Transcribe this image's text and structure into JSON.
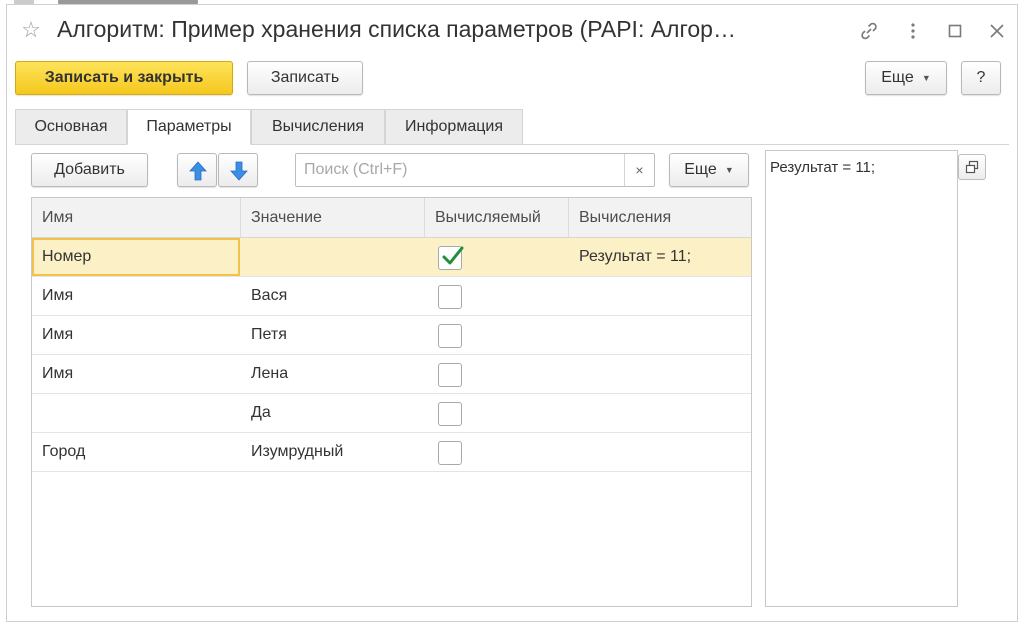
{
  "window": {
    "title": "Алгоритм: Пример хранения списка параметров (PAPI: Алгор…"
  },
  "command_bar": {
    "save_close_label": "Записать и закрыть",
    "save_label": "Записать",
    "more_label": "Еще",
    "help_label": "?"
  },
  "tabs": [
    {
      "label": "Основная",
      "active": false
    },
    {
      "label": "Параметры",
      "active": true
    },
    {
      "label": "Вычисления",
      "active": false
    },
    {
      "label": "Информация",
      "active": false
    }
  ],
  "table_toolbar": {
    "add_label": "Добавить",
    "search_placeholder": "Поиск (Ctrl+F)",
    "clear_label": "×",
    "more_label": "Еще"
  },
  "table": {
    "columns": [
      "Имя",
      "Значение",
      "Вычисляемый",
      "Вычисления"
    ],
    "rows": [
      {
        "name": "Номер",
        "value": "",
        "computed": true,
        "calc": "Результат = 11;",
        "selected": true
      },
      {
        "name": "Имя",
        "value": "Вася",
        "computed": false,
        "calc": "",
        "selected": false
      },
      {
        "name": "Имя",
        "value": "Петя",
        "computed": false,
        "calc": "",
        "selected": false
      },
      {
        "name": "Имя",
        "value": "Лена",
        "computed": false,
        "calc": "",
        "selected": false
      },
      {
        "name": "",
        "value": "Да",
        "computed": false,
        "calc": "",
        "selected": false
      },
      {
        "name": "Город",
        "value": "Изумрудный",
        "computed": false,
        "calc": "",
        "selected": false
      }
    ]
  },
  "side_panel": {
    "text": "Результат = 11;"
  },
  "colors": {
    "primary_button": "#f5c81e",
    "selected_row": "#fbf0c6",
    "focus_border": "#f2c24a",
    "check_mark": "#1f8f3a",
    "arrow_icon": "#3a8ee6"
  }
}
